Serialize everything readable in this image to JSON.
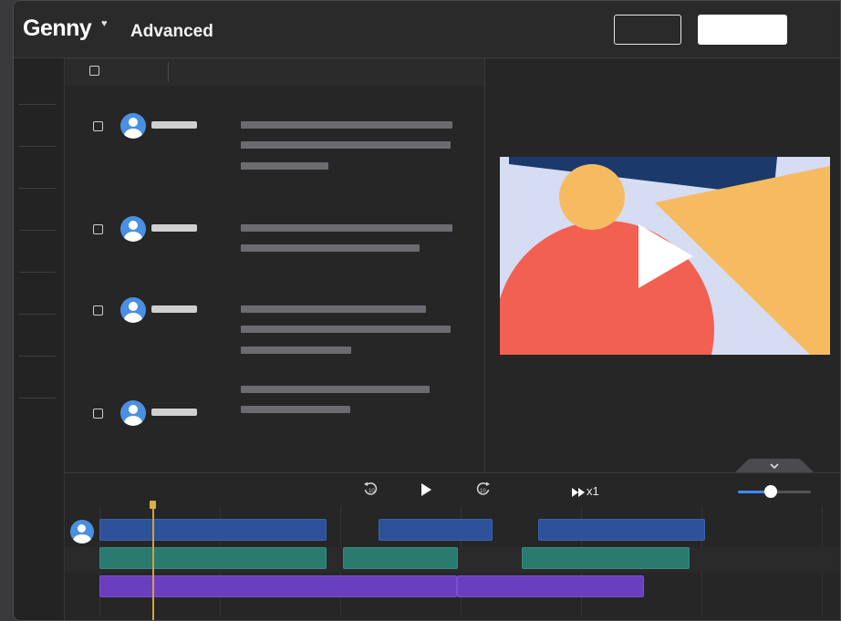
{
  "header": {
    "brand": "Genny",
    "brand_mark": "♥",
    "mode": "Advanced"
  },
  "playback": {
    "speed_label": "x1",
    "volume_level": 0.45
  },
  "icons": {
    "rewind": "rewind-10-icon",
    "play": "play-icon",
    "forward": "forward-10-icon",
    "fast_forward": "fast-forward-icon",
    "chevron": "chevron-down-icon"
  },
  "colors": {
    "accent_blue": "#3d8bff",
    "clip_blue": "#2d5299",
    "clip_teal": "#2a7a70",
    "clip_purple": "#6a3fbf",
    "playhead": "#d4a13c"
  }
}
